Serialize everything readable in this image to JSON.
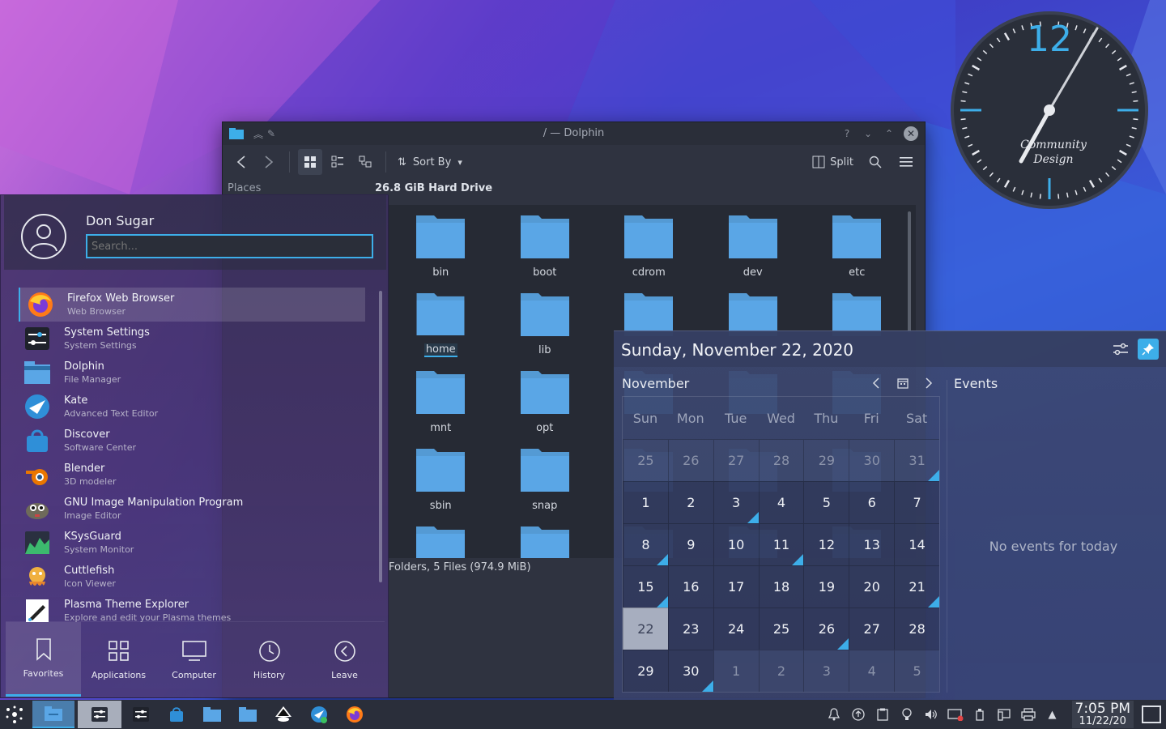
{
  "colors": {
    "accent": "#3daee9",
    "folder": "#5aa6e6",
    "panel": "#2a2e3a"
  },
  "dolphin": {
    "title": "/ — Dolphin",
    "sort_label": "Sort By",
    "split_label": "Split",
    "places_label": "Places",
    "drive_label": "26.8 GiB Hard Drive",
    "status": "Folders, 5 Files (974.9 MiB)",
    "folders": [
      "bin",
      "boot",
      "cdrom",
      "dev",
      "etc",
      "home",
      "lib",
      "",
      "",
      "",
      "mnt",
      "opt",
      "",
      "",
      "",
      "sbin",
      "snap",
      "",
      "",
      "",
      "",
      "",
      "",
      "",
      ""
    ],
    "selected_folder": "home"
  },
  "clock_widget": {
    "hour_label": "12",
    "brand_line1": "Community",
    "brand_line2": "Design"
  },
  "launcher": {
    "user_name": "Don Sugar",
    "search_placeholder": "Search...",
    "apps": [
      {
        "name": "Firefox Web Browser",
        "desc": "Web Browser",
        "icon": "firefox-icon"
      },
      {
        "name": "System Settings",
        "desc": "System Settings",
        "icon": "settings-icon"
      },
      {
        "name": "Dolphin",
        "desc": "File Manager",
        "icon": "dolphin-icon"
      },
      {
        "name": "Kate",
        "desc": "Advanced Text Editor",
        "icon": "kate-icon"
      },
      {
        "name": "Discover",
        "desc": "Software Center",
        "icon": "discover-icon"
      },
      {
        "name": "Blender",
        "desc": "3D modeler",
        "icon": "blender-icon"
      },
      {
        "name": "GNU Image Manipulation Program",
        "desc": "Image Editor",
        "icon": "gimp-icon"
      },
      {
        "name": "KSysGuard",
        "desc": "System Monitor",
        "icon": "ksysguard-icon"
      },
      {
        "name": "Cuttlefish",
        "desc": "Icon Viewer",
        "icon": "cuttlefish-icon"
      },
      {
        "name": "Plasma Theme Explorer",
        "desc": "Explore and edit your Plasma themes",
        "icon": "theme-explorer-icon"
      }
    ],
    "tabs": [
      {
        "label": "Favorites",
        "icon": "bookmark-icon"
      },
      {
        "label": "Applications",
        "icon": "grid-icon"
      },
      {
        "label": "Computer",
        "icon": "monitor-icon"
      },
      {
        "label": "History",
        "icon": "clock-icon"
      },
      {
        "label": "Leave",
        "icon": "leave-icon"
      }
    ]
  },
  "calendar": {
    "full_date": "Sunday, November 22, 2020",
    "month": "November",
    "day_names": [
      "Sun",
      "Mon",
      "Tue",
      "Wed",
      "Thu",
      "Fri",
      "Sat"
    ],
    "weeks": [
      [
        {
          "d": "25",
          "dim": true
        },
        {
          "d": "26",
          "dim": true
        },
        {
          "d": "27",
          "dim": true
        },
        {
          "d": "28",
          "dim": true
        },
        {
          "d": "29",
          "dim": true
        },
        {
          "d": "30",
          "dim": true
        },
        {
          "d": "31",
          "dim": true,
          "ev": true
        }
      ],
      [
        {
          "d": "1"
        },
        {
          "d": "2"
        },
        {
          "d": "3",
          "ev": true
        },
        {
          "d": "4"
        },
        {
          "d": "5"
        },
        {
          "d": "6"
        },
        {
          "d": "7"
        }
      ],
      [
        {
          "d": "8",
          "ev": true
        },
        {
          "d": "9"
        },
        {
          "d": "10"
        },
        {
          "d": "11",
          "ev": true
        },
        {
          "d": "12"
        },
        {
          "d": "13"
        },
        {
          "d": "14"
        }
      ],
      [
        {
          "d": "15",
          "ev": true
        },
        {
          "d": "16"
        },
        {
          "d": "17"
        },
        {
          "d": "18"
        },
        {
          "d": "19"
        },
        {
          "d": "20"
        },
        {
          "d": "21",
          "ev": true
        }
      ],
      [
        {
          "d": "22",
          "today": true
        },
        {
          "d": "23"
        },
        {
          "d": "24"
        },
        {
          "d": "25"
        },
        {
          "d": "26",
          "ev": true
        },
        {
          "d": "27"
        },
        {
          "d": "28"
        }
      ],
      [
        {
          "d": "29"
        },
        {
          "d": "30",
          "ev": true
        },
        {
          "d": "1",
          "dim": true
        },
        {
          "d": "2",
          "dim": true
        },
        {
          "d": "3",
          "dim": true
        },
        {
          "d": "4",
          "dim": true
        },
        {
          "d": "5",
          "dim": true
        }
      ]
    ],
    "events_title": "Events",
    "no_events": "No events for today"
  },
  "taskbar": {
    "time": "7:05 PM",
    "date": "11/22/20"
  }
}
